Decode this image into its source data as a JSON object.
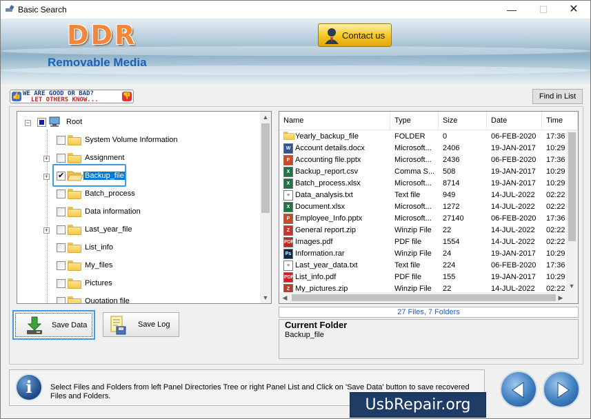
{
  "window": {
    "title": "Basic Search",
    "minimize": "—",
    "maximize": "☐",
    "close": "✕"
  },
  "banner": {
    "logo": "DDR",
    "subtitle": "Removable Media",
    "contact_label": "Contact us"
  },
  "rate_badge": {
    "line1": "WE ARE GOOD OR BAD?",
    "line2": "LET OTHERS KNOW..."
  },
  "find_button": "Find in List",
  "tree": {
    "root": "Root",
    "items": [
      {
        "label": "System Volume Information",
        "checked": false,
        "expandable": false
      },
      {
        "label": "Assignment",
        "checked": false,
        "expandable": true
      },
      {
        "label": "Backup_file",
        "checked": true,
        "expandable": true,
        "selected": true
      },
      {
        "label": "Batch_process",
        "checked": false,
        "expandable": false
      },
      {
        "label": "Data information",
        "checked": false,
        "expandable": false
      },
      {
        "label": "Last_year_file",
        "checked": false,
        "expandable": true
      },
      {
        "label": "List_info",
        "checked": false,
        "expandable": false
      },
      {
        "label": "My_files",
        "checked": false,
        "expandable": false
      },
      {
        "label": "Pictures",
        "checked": false,
        "expandable": false
      },
      {
        "label": "Quotation file",
        "checked": false,
        "expandable": false
      }
    ]
  },
  "list": {
    "columns": [
      "Name",
      "Type",
      "Size",
      "Date",
      "Time"
    ],
    "rows": [
      {
        "icon": "folder",
        "name": "Yearly_backup_file",
        "type": "FOLDER",
        "size": "0",
        "date": "06-FEB-2020",
        "time": "17:36"
      },
      {
        "icon": "docx",
        "name": "Account details.docx",
        "type": "Microsoft...",
        "size": "2406",
        "date": "19-JAN-2017",
        "time": "10:29"
      },
      {
        "icon": "pptx",
        "name": "Accounting file.pptx",
        "type": "Microsoft...",
        "size": "2436",
        "date": "06-FEB-2020",
        "time": "17:36"
      },
      {
        "icon": "xlsx",
        "name": "Backup_report.csv",
        "type": "Comma S...",
        "size": "508",
        "date": "19-JAN-2017",
        "time": "10:29"
      },
      {
        "icon": "xlsx",
        "name": "Batch_process.xlsx",
        "type": "Microsoft...",
        "size": "8714",
        "date": "19-JAN-2017",
        "time": "10:29"
      },
      {
        "icon": "txt",
        "name": "Data_analysis.txt",
        "type": "Text file",
        "size": "949",
        "date": "14-JUL-2022",
        "time": "02:22"
      },
      {
        "icon": "xlsx",
        "name": "Document.xlsx",
        "type": "Microsoft...",
        "size": "1272",
        "date": "14-JUL-2022",
        "time": "02:22"
      },
      {
        "icon": "pptx",
        "name": "Employee_Info.pptx",
        "type": "Microsoft...",
        "size": "27140",
        "date": "06-FEB-2020",
        "time": "17:36"
      },
      {
        "icon": "zip",
        "name": "General report.zip",
        "type": "Winzip File",
        "size": "22",
        "date": "14-JUL-2022",
        "time": "02:22"
      },
      {
        "icon": "pdf",
        "name": "Images.pdf",
        "type": "PDF file",
        "size": "1554",
        "date": "14-JUL-2022",
        "time": "02:22"
      },
      {
        "icon": "ps",
        "name": "Information.rar",
        "type": "Winzip File",
        "size": "24",
        "date": "19-JAN-2017",
        "time": "10:29"
      },
      {
        "icon": "txt",
        "name": "Last_year_data.txt",
        "type": "Text file",
        "size": "224",
        "date": "06-FEB-2020",
        "time": "17:36"
      },
      {
        "icon": "pdf",
        "name": "List_info.pdf",
        "type": "PDF file",
        "size": "155",
        "date": "19-JAN-2017",
        "time": "10:29"
      },
      {
        "icon": "zip",
        "name": "My_pictures.zip",
        "type": "Winzip File",
        "size": "22",
        "date": "14-JUL-2022",
        "time": "02:22"
      }
    ]
  },
  "status_count": "27 Files, 7 Folders",
  "current_folder": {
    "title": "Current Folder",
    "value": "Backup_file"
  },
  "buttons": {
    "save_data": "Save Data",
    "save_log": "Save Log"
  },
  "info_text": "Select Files and Folders from left Panel Directories Tree or right Panel List and Click on 'Save Data' button to save recovered Files and Folders.",
  "brand": "UsbRepair.org",
  "icon_colors": {
    "docx": "#2b579a",
    "pptx": "#d24726",
    "xlsx": "#217346",
    "txt": "#ffffff",
    "zip": "#c0392b",
    "pdf": "#d02020",
    "ps": "#0b2a4a",
    "folder": "#f5c74c"
  }
}
